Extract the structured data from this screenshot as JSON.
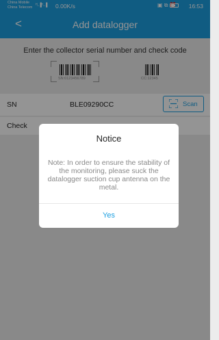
{
  "status_bar": {
    "carrier_1": "China Mobile",
    "carrier_2": "China Telecom",
    "signal": "ᴴ‥▐ ᴴ‥▐",
    "network_speed": "0.00K/s",
    "time": "16:53",
    "icons": [
      "nfc-icon",
      "vibrate-icon",
      "alarm-icon",
      "battery-icon"
    ]
  },
  "header": {
    "back_symbol": "<",
    "title": "Add datalogger"
  },
  "instructions": "Enter the collector serial number and check code",
  "label_image": {
    "sn_caption": "SN:0123456789",
    "cc_caption": "CC:12345"
  },
  "form": {
    "sn_label": "SN",
    "sn_value": "BLE09290CC",
    "scan_label": "Scan",
    "check_label": "Check"
  },
  "dialog": {
    "title": "Notice",
    "message": "Note: In order to ensure the stability of the monitoring, please suck the datalogger suction cup antenna on the metal.",
    "button": "Yes"
  },
  "colors": {
    "accent": "#1d9fe0",
    "background": "#ececec",
    "dialog_text": "#888888",
    "overlay": "rgba(0,0,0,0.42)"
  }
}
